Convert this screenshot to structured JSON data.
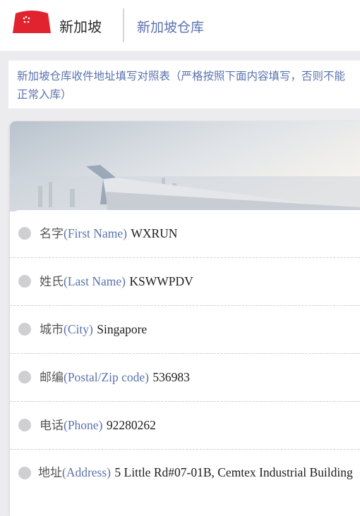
{
  "header": {
    "country": "新加坡",
    "title": "新加坡仓库"
  },
  "notice": {
    "text": "新加坡仓库收件地址填写对照表（严格按照下面内容填写，否则不能正常入库）"
  },
  "colors": {
    "accent": "#5a72ad",
    "flag_red": "#e0232f",
    "bullet": "#cfcfd2"
  },
  "fields": [
    {
      "label": "名字",
      "label_en": "(First Name)",
      "value": "WXRUN"
    },
    {
      "label": "姓氏",
      "label_en": "(Last Name)",
      "value": "KSWWPDV"
    },
    {
      "label": "城市",
      "label_en": "(City)",
      "value": "Singapore"
    },
    {
      "label": "邮编",
      "label_en": "(Postal/Zip code)",
      "value": "536983"
    },
    {
      "label": "电话",
      "label_en": "(Phone)",
      "value": "92280262"
    },
    {
      "label": "地址",
      "label_en": "(Address)",
      "value": "5 Little Rd#07-01B, Cemtex Industrial Building"
    }
  ],
  "icons": {
    "flag": "singapore-flag-icon",
    "bullet": "bullet-icon"
  }
}
